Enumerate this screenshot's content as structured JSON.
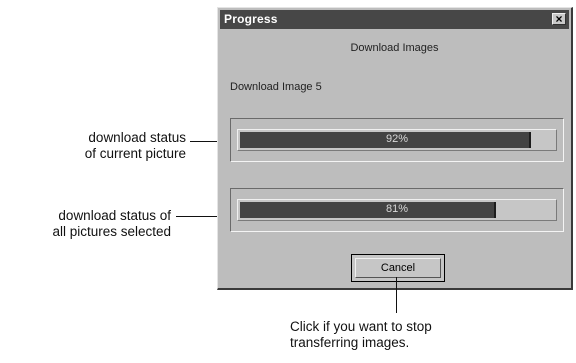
{
  "window": {
    "title": "Progress",
    "close_glyph": "×",
    "task_title": "Download Images",
    "task_status": "Download Image 5"
  },
  "progress": {
    "current": {
      "label": "92%",
      "value": 0.92
    },
    "all": {
      "label": "81%",
      "value": 0.81
    }
  },
  "buttons": {
    "cancel": "Cancel"
  },
  "callouts": {
    "current_line1": "download status",
    "current_line2": "of current picture",
    "all_line1": "download status of",
    "all_line2": "all pictures selected",
    "cancel_line1": "Click if you want to stop",
    "cancel_line2": "transferring images."
  },
  "colors": {
    "dialog_bg": "#bdbdbd",
    "titlebar_bg": "#474747",
    "bar_fill": "#434343"
  }
}
